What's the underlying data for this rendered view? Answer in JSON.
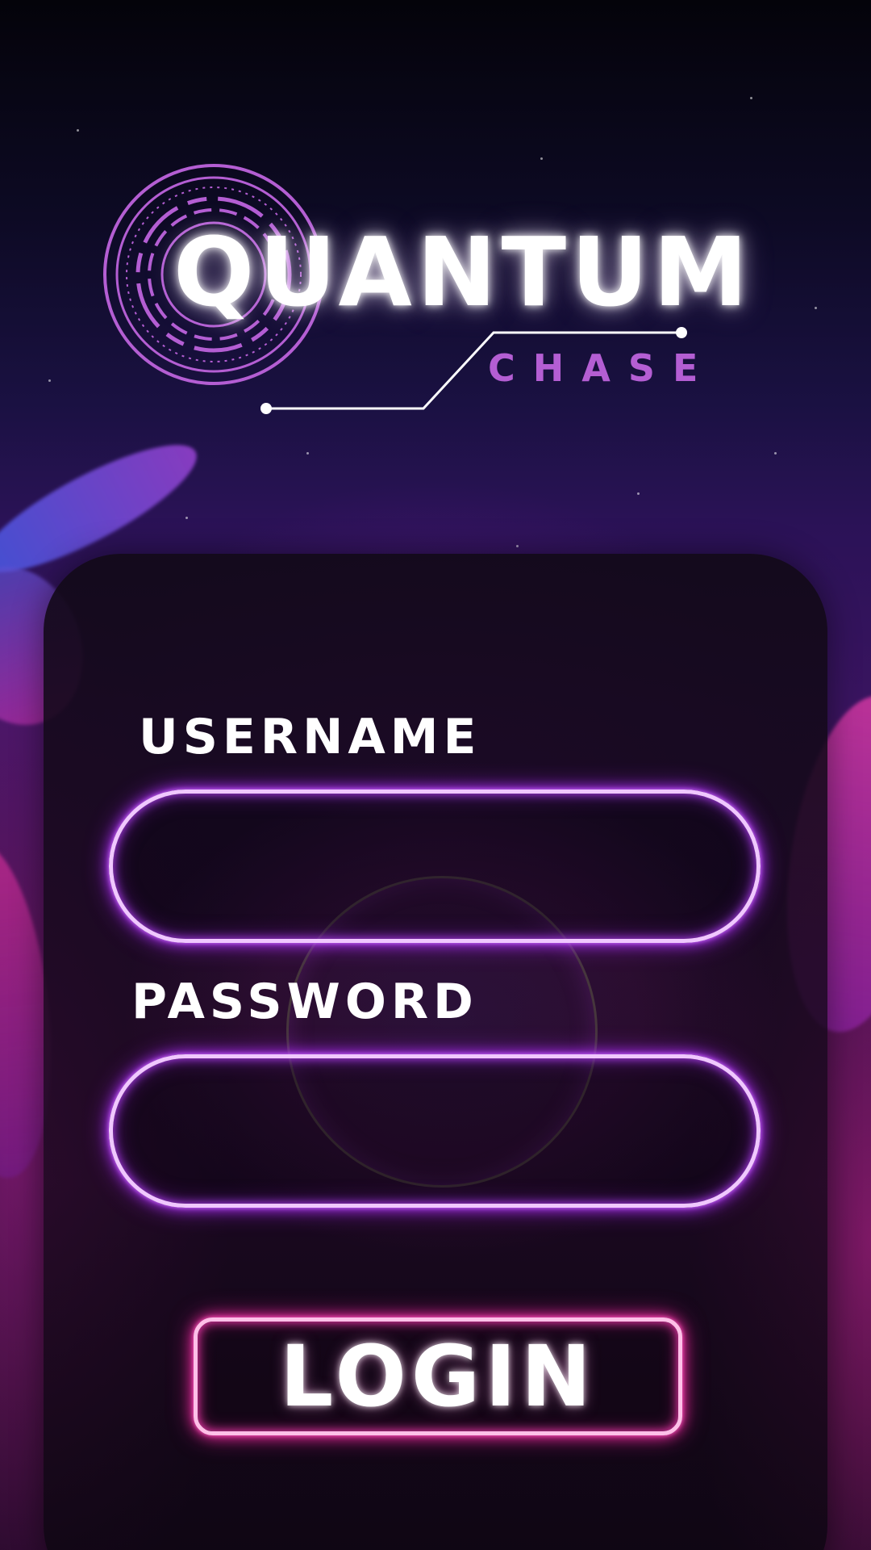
{
  "logo": {
    "title": "QUANTUM",
    "subtitle": "CHASE",
    "icon": "concentric-circles-emblem"
  },
  "form": {
    "username_label": "USERNAME",
    "username_value": "",
    "password_label": "PASSWORD",
    "password_value": "",
    "login_label": "LOGIN"
  },
  "colors": {
    "background_top": "#04030a",
    "background_mid": "#3a1460",
    "input_glow": "#a830f0",
    "button_glow": "#f02a9f",
    "subtitle": "#b45ed3",
    "text": "#ffffff"
  }
}
